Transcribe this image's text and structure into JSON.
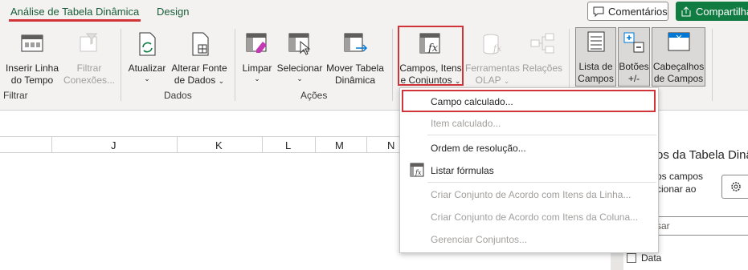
{
  "tabs": {
    "active": "Análise de Tabela Dinâmica",
    "design": "Design",
    "comments_label": "Comentários",
    "share_label": "Compartilhar"
  },
  "ribbon": {
    "filtrar": {
      "group_label": "Filtrar",
      "inserir_linha_tempo": [
        "Inserir Linha",
        "do Tempo"
      ],
      "filtrar_conexoes": [
        "Filtrar",
        "Conexões..."
      ]
    },
    "dados": {
      "group_label": "Dados",
      "atualizar": "Atualizar",
      "alterar_fonte": [
        "Alterar Fonte",
        "de Dados"
      ]
    },
    "acoes": {
      "group_label": "Ações",
      "limpar": "Limpar",
      "selecionar": "Selecionar",
      "mover_tabela": [
        "Mover Tabela",
        "Dinâmica"
      ]
    },
    "calculos": {
      "campos_itens": [
        "Campos, Itens",
        "e Conjuntos"
      ],
      "ferramentas_olap": [
        "Ferramentas",
        "OLAP"
      ],
      "relacoes": "Relações"
    },
    "mostrar": {
      "lista_campos": [
        "Lista de",
        "Campos"
      ],
      "botoes": [
        "Botões",
        "+/-"
      ],
      "cabecalhos": [
        "Cabeçalhos",
        "de Campos"
      ]
    }
  },
  "columns": [
    "J",
    "K",
    "L",
    "M",
    "N"
  ],
  "menu": {
    "items": [
      {
        "label": "Campo calculado...",
        "enabled": true,
        "icon": "none"
      },
      {
        "label": "Item calculado...",
        "enabled": false,
        "icon": "none"
      },
      {
        "label": "Ordem de resolução...",
        "enabled": true,
        "icon": "none"
      },
      {
        "label": "Listar fórmulas",
        "enabled": true,
        "icon": "list-formulas-icon"
      },
      {
        "label": "Criar Conjunto de Acordo com Itens da Linha...",
        "enabled": false,
        "icon": "none"
      },
      {
        "label": "Criar Conjunto de Acordo com Itens da Coluna...",
        "enabled": false,
        "icon": "none"
      },
      {
        "label": "Gerenciar Conjuntos...",
        "enabled": false,
        "icon": "none"
      }
    ]
  },
  "panel": {
    "title": "os da Tabela Dinâ",
    "desc": [
      "os campos",
      "cionar ao",
      ":"
    ],
    "search_placeholder": "sar",
    "field": "Data"
  },
  "colors": {
    "accent_green": "#107c41",
    "highlight_red": "#d13438",
    "ribbon_bg": "#f3f2f1"
  }
}
